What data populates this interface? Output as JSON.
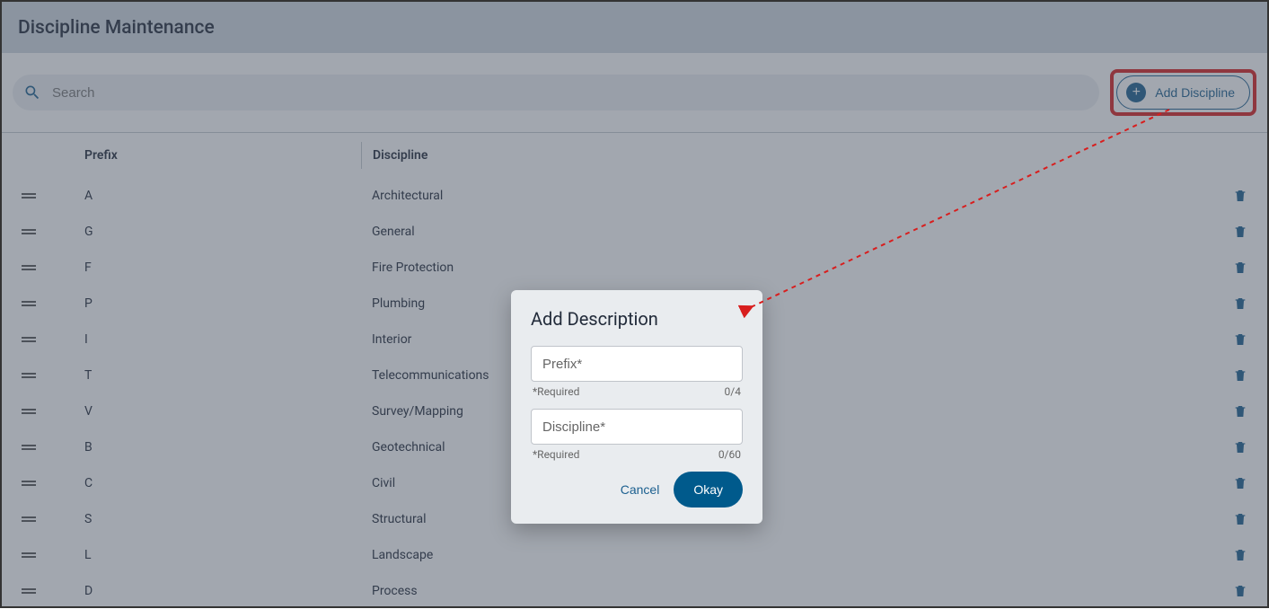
{
  "header": {
    "title": "Discipline Maintenance"
  },
  "toolbar": {
    "search_placeholder": "Search",
    "add_label": "Add Discipline"
  },
  "columns": {
    "prefix": "Prefix",
    "discipline": "Discipline"
  },
  "rows": [
    {
      "prefix": "A",
      "discipline": "Architectural"
    },
    {
      "prefix": "G",
      "discipline": "General"
    },
    {
      "prefix": "F",
      "discipline": "Fire Protection"
    },
    {
      "prefix": "P",
      "discipline": "Plumbing"
    },
    {
      "prefix": "I",
      "discipline": "Interior"
    },
    {
      "prefix": "T",
      "discipline": "Telecommunications"
    },
    {
      "prefix": "V",
      "discipline": "Survey/Mapping"
    },
    {
      "prefix": "B",
      "discipline": "Geotechnical"
    },
    {
      "prefix": "C",
      "discipline": "Civil"
    },
    {
      "prefix": "S",
      "discipline": "Structural"
    },
    {
      "prefix": "L",
      "discipline": "Landscape"
    },
    {
      "prefix": "D",
      "discipline": "Process"
    }
  ],
  "modal": {
    "title": "Add Description",
    "prefix_placeholder": "Prefix*",
    "prefix_required": "*Required",
    "prefix_counter": "0/4",
    "discipline_placeholder": "Discipline*",
    "discipline_required": "*Required",
    "discipline_counter": "0/60",
    "cancel_label": "Cancel",
    "okay_label": "Okay"
  },
  "annotation": {
    "highlight_color": "#d81e1e"
  }
}
